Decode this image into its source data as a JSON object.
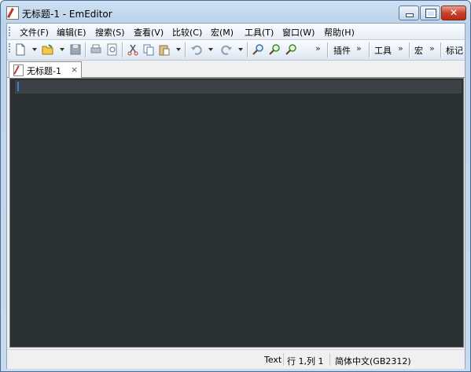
{
  "window": {
    "title": "无标题-1 - EmEditor"
  },
  "menu": [
    "文件(F)",
    "编辑(E)",
    "搜索(S)",
    "查看(V)",
    "比较(C)",
    "宏(M)",
    "工具(T)",
    "窗口(W)",
    "帮助(H)"
  ],
  "toolbar": {
    "icons": [
      "new-file-icon",
      "open-folder-icon",
      "save-icon",
      "print-icon",
      "print-preview-icon",
      "cut-icon",
      "copy-icon",
      "paste-icon",
      "undo-icon",
      "redo-icon",
      "find-icon",
      "find-next-icon",
      "find-prev-icon"
    ],
    "overflow": "»",
    "plugins_label": "插件",
    "tools_label": "工具",
    "macros_label": "宏",
    "bookmarks_label": "标记"
  },
  "tabs": [
    {
      "label": "无标题-1",
      "close": "×"
    }
  ],
  "status": {
    "mode": "Text",
    "position": "行 1,列 1",
    "encoding": "简体中文(GB2312)"
  },
  "colors": {
    "editor_bg": "#2c3133",
    "current_line": "#3c4245",
    "caret": "#3a7fcf"
  }
}
